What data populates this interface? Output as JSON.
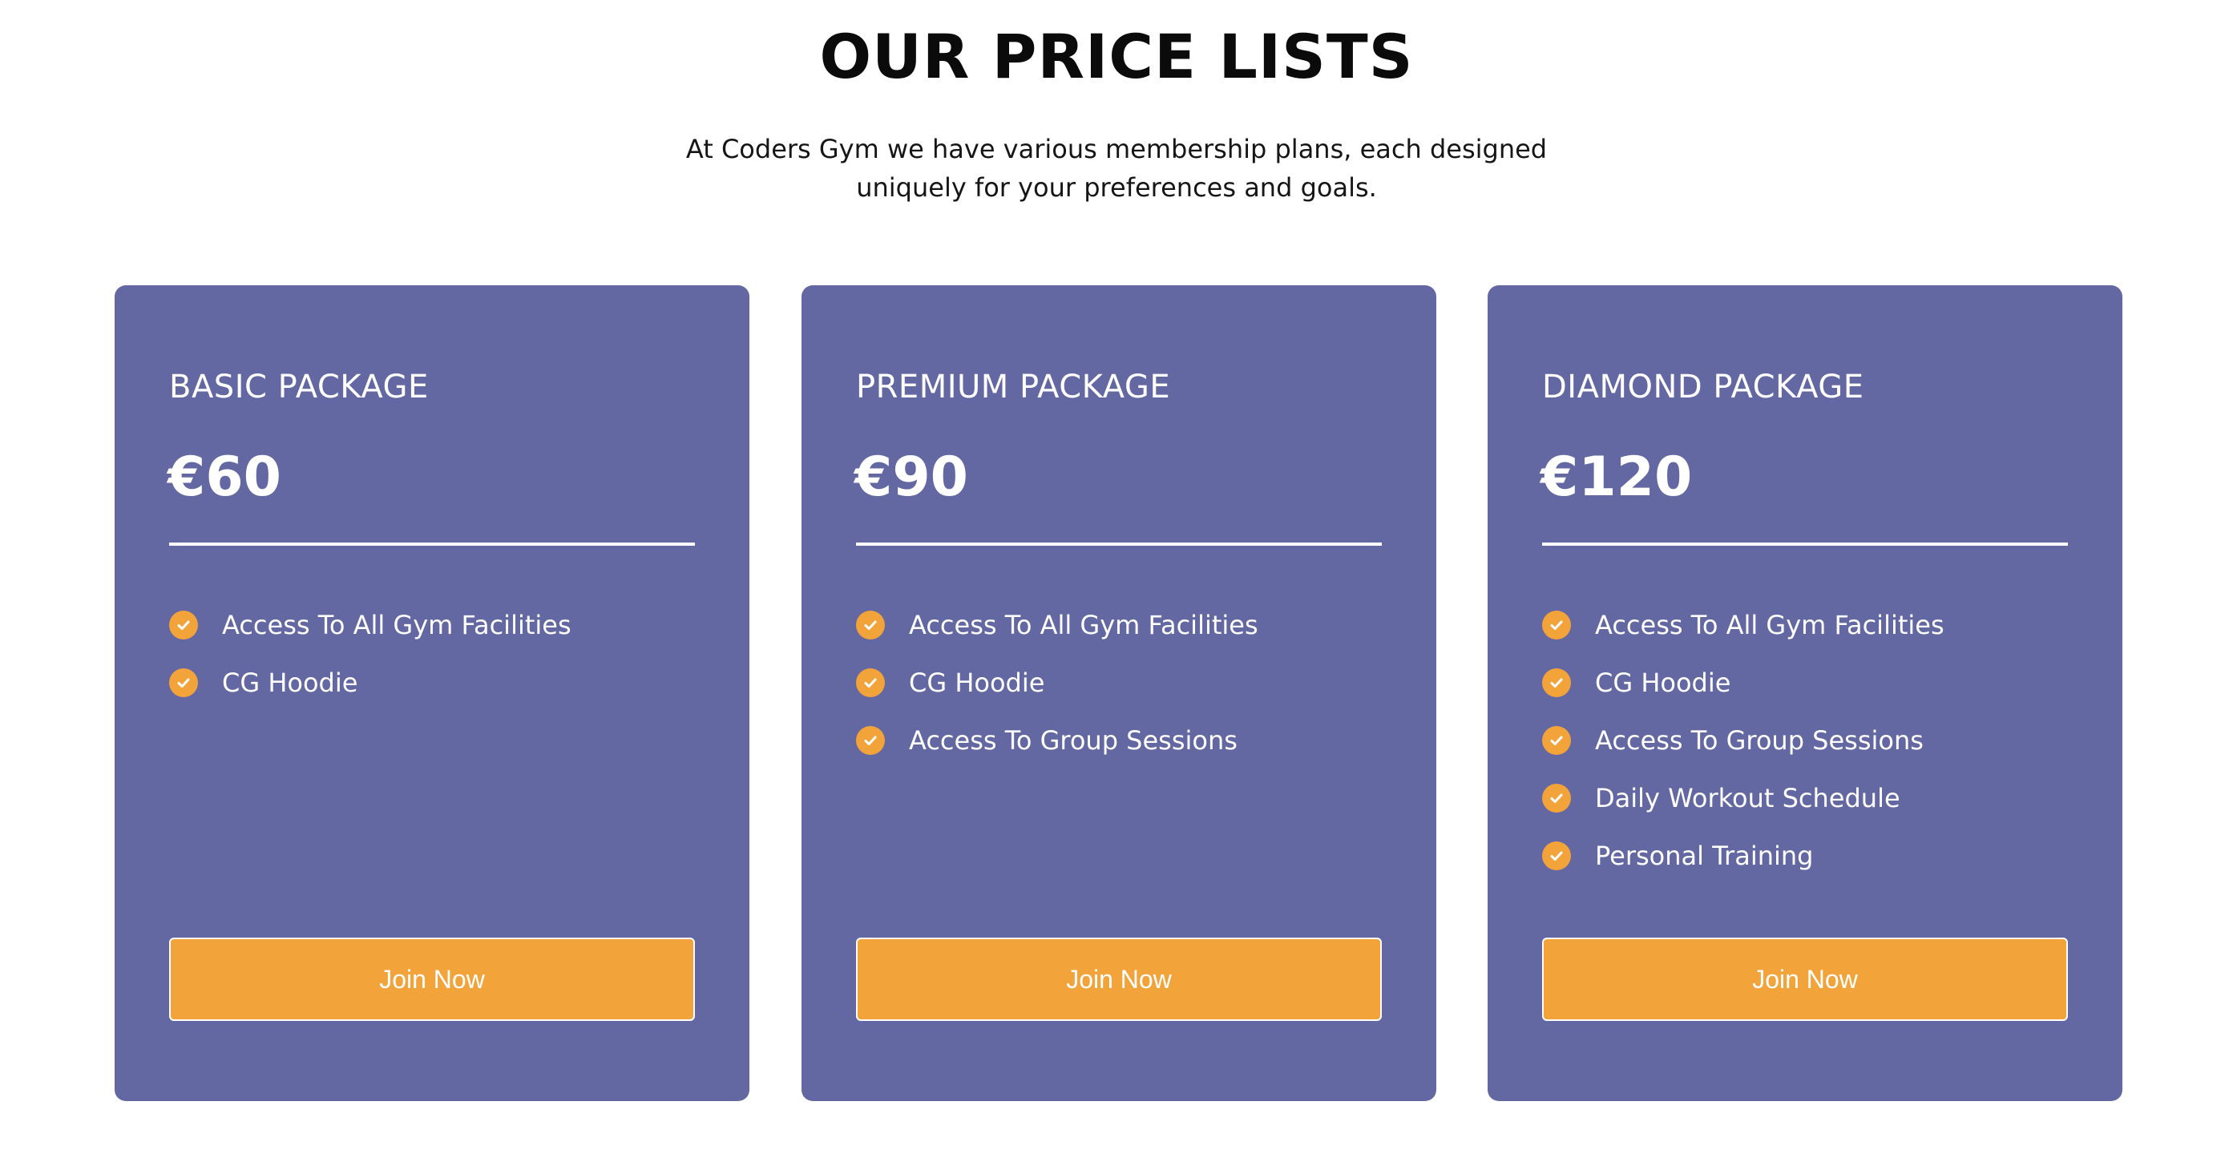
{
  "section": {
    "title": "OUR PRICE LISTS",
    "subtitle": "At Coders Gym we have various membership plans, each designed uniquely for your preferences and goals."
  },
  "colors": {
    "card_background": "#6367a2",
    "accent": "#f2a33a",
    "text_on_card": "#ffffff"
  },
  "packages": [
    {
      "name": "BASIC PACKAGE",
      "price": "€60",
      "features": [
        "Access To All Gym Facilities",
        "CG Hoodie"
      ],
      "button_label": "Join Now",
      "feature_icon": "check-circle-icon"
    },
    {
      "name": "PREMIUM PACKAGE",
      "price": "€90",
      "features": [
        "Access To All Gym Facilities",
        "CG Hoodie",
        "Access To Group Sessions"
      ],
      "button_label": "Join Now",
      "feature_icon": "check-circle-icon"
    },
    {
      "name": "DIAMOND PACKAGE",
      "price": "€120",
      "features": [
        "Access To All Gym Facilities",
        "CG Hoodie",
        "Access To Group Sessions",
        "Daily Workout Schedule",
        "Personal Training"
      ],
      "button_label": "Join Now",
      "feature_icon": "check-circle-icon"
    }
  ]
}
